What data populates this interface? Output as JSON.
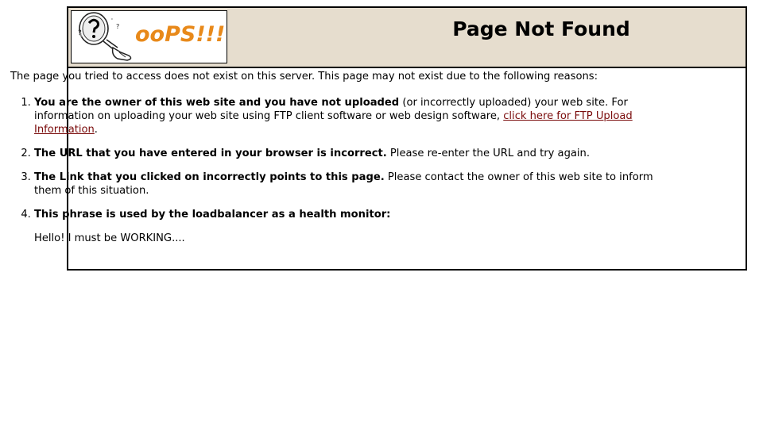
{
  "header": {
    "logo_text": "ooPS!!!",
    "title": "Page Not Found"
  },
  "content": {
    "intro": "The page you tried to access does not exist on this server. This page may not exist due to the following reasons:",
    "reasons": [
      {
        "bold": "You are the owner of this web site and you have not uploaded",
        "text": " (or incorrectly uploaded) your web site. For information on uploading your web site using FTP client software or web design software, ",
        "link": "click here for FTP Upload Information",
        "after": "."
      },
      {
        "bold": "The URL that you have entered in your browser is incorrect.",
        "text": " Please re-enter the URL and try again."
      },
      {
        "bold": "The Link that you clicked on incorrectly points to this page.",
        "text": " Please contact the owner of this web site to inform them of this situation."
      },
      {
        "bold": "This phrase is used by the loadbalancer as a health monitor:",
        "health_text": "Hello! I must be WORKING...."
      }
    ]
  },
  "colors": {
    "header_bg": "#e6ddce",
    "logo_orange": "#e8891a",
    "link": "#7a0b0b"
  },
  "icons": {
    "logo": "confused-face-icon"
  }
}
